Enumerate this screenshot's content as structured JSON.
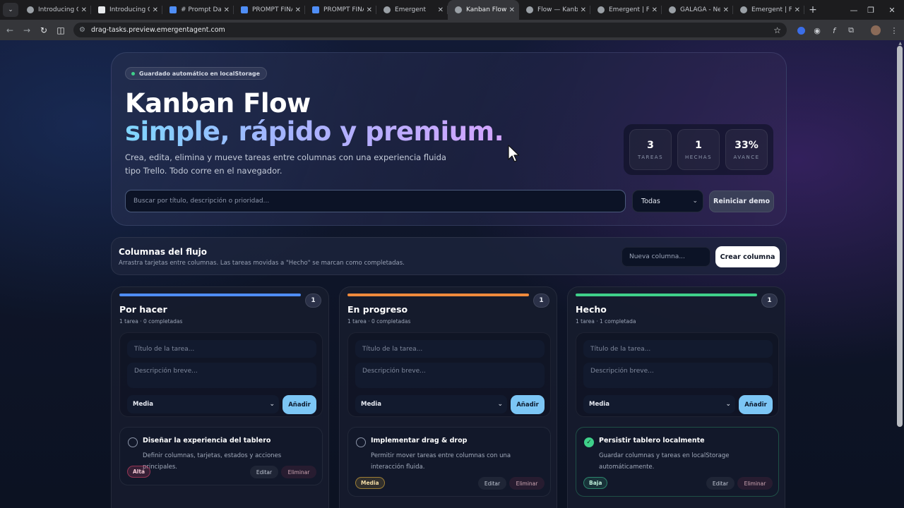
{
  "browser": {
    "tabs": [
      {
        "label": "Introducing GPT",
        "icon": "globe-icon"
      },
      {
        "label": "Introducing Claude",
        "icon": "ai-icon"
      },
      {
        "label": "# Prompt Dash",
        "icon": "doc-icon"
      },
      {
        "label": "PROMPT FINAL",
        "icon": "doc-icon"
      },
      {
        "label": "PROMPT FINAL",
        "icon": "doc-icon"
      },
      {
        "label": "Emergent",
        "icon": "globe-icon"
      },
      {
        "label": "Kanban Flow —",
        "icon": "globe-icon",
        "active": true
      },
      {
        "label": "Flow — Kanban",
        "icon": "globe-icon"
      },
      {
        "label": "Emergent | Full",
        "icon": "globe-icon"
      },
      {
        "label": "GALAGA - Neo",
        "icon": "globe-icon"
      },
      {
        "label": "Emergent | Full",
        "icon": "globe-icon"
      }
    ],
    "url": "drag-tasks.preview.emergentagent.com"
  },
  "hero": {
    "autosave": "Guardado automático en localStorage",
    "title": "Kanban Flow",
    "subtitle": "simple, rápido y premium.",
    "description": "Crea, edita, elimina y mueve tareas entre columnas con una experiencia fluida tipo Trello. Todo corre en el navegador.",
    "stats": [
      {
        "value": "3",
        "label": "TAREAS"
      },
      {
        "value": "1",
        "label": "HECHAS"
      },
      {
        "value": "33%",
        "label": "AVANCE"
      }
    ],
    "search_placeholder": "Buscar por título, descripción o prioridad...",
    "filter_value": "Todas",
    "reset_label": "Reiniciar demo"
  },
  "flow": {
    "title": "Columnas del flujo",
    "description": "Arrastra tarjetas entre columnas. Las tareas movidas a \"Hecho\" se marcan como completadas.",
    "new_column_placeholder": "Nueva columna...",
    "create_label": "Crear columna"
  },
  "columns": [
    {
      "title": "Por hacer",
      "count": "1",
      "meta": "1 tarea · 0 completadas",
      "accent": "#4f8df5",
      "form": {
        "title_placeholder": "Título de la tarea...",
        "desc_placeholder": "Descripción breve...",
        "priority": "Media",
        "add_label": "Añadir"
      },
      "task": {
        "title": "Diseñar la experiencia del tablero",
        "description": "Definir columnas, tarjetas, estados y acciones principales.",
        "priority": "Alta",
        "edit": "Editar",
        "delete": "Eliminar",
        "done": false
      }
    },
    {
      "title": "En progreso",
      "count": "1",
      "meta": "1 tarea · 0 completadas",
      "accent": "#f08a3c",
      "form": {
        "title_placeholder": "Título de la tarea...",
        "desc_placeholder": "Descripción breve...",
        "priority": "Media",
        "add_label": "Añadir"
      },
      "task": {
        "title": "Implementar drag & drop",
        "description": "Permitir mover tareas entre columnas con una interacción fluida.",
        "priority": "Media",
        "edit": "Editar",
        "delete": "Eliminar",
        "done": false
      }
    },
    {
      "title": "Hecho",
      "count": "1",
      "meta": "1 tarea · 1 completada",
      "accent": "#3fd08a",
      "form": {
        "title_placeholder": "Título de la tarea...",
        "desc_placeholder": "Descripción breve...",
        "priority": "Media",
        "add_label": "Añadir"
      },
      "task": {
        "title": "Persistir tablero localmente",
        "description": "Guardar columnas y tareas en localStorage automáticamente.",
        "priority": "Baja",
        "edit": "Editar",
        "delete": "Eliminar",
        "done": true
      }
    }
  ]
}
